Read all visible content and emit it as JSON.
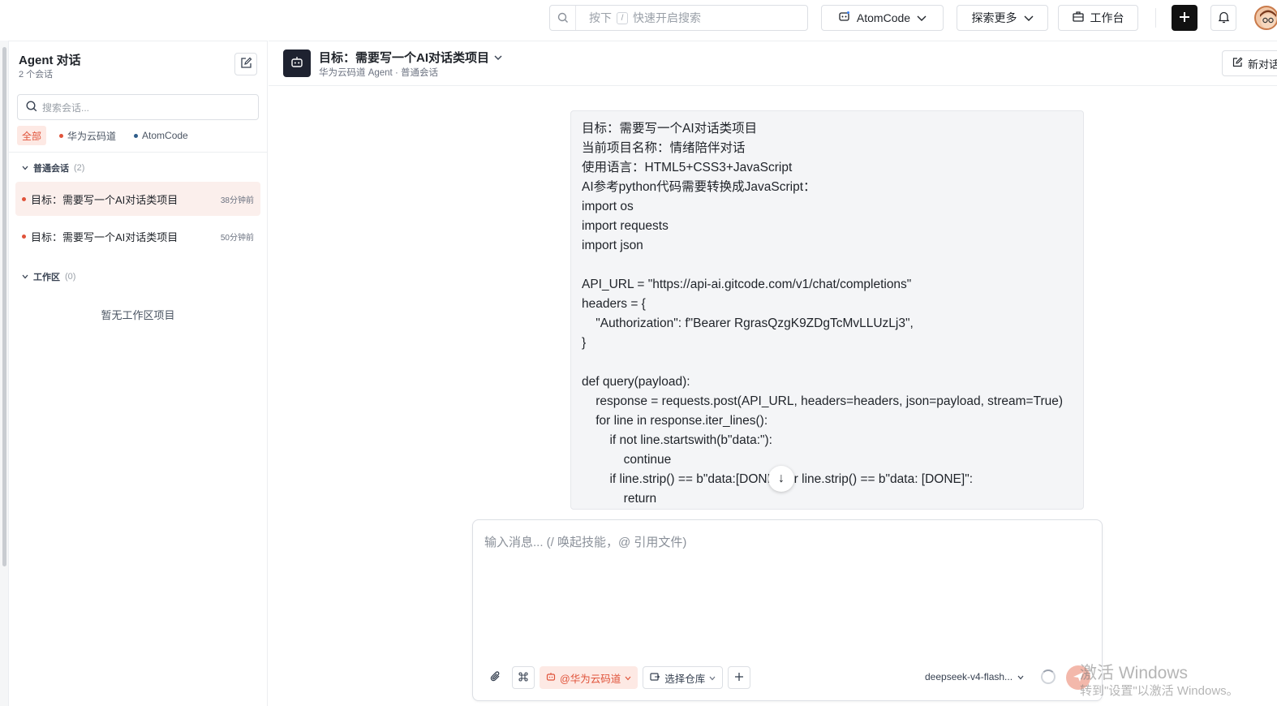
{
  "topbar": {
    "search_hint_prefix": "按下",
    "search_hint_key": "/",
    "search_hint_suffix": "快速开启搜索",
    "atomcode_label": "AtomCode",
    "explore_label": "探索更多",
    "workbench_label": "工作台"
  },
  "sidebar": {
    "title": "Agent 对话",
    "subtitle": "2 个会话",
    "search_placeholder": "搜索会话...",
    "filters": [
      {
        "label": "全部"
      },
      {
        "label": "华为云码道",
        "color": "#e0533a"
      },
      {
        "label": "AtomCode",
        "color": "#2f5d8a"
      }
    ],
    "groups": {
      "normal": {
        "label": "普通会话",
        "count": "(2)"
      },
      "workspace": {
        "label": "工作区",
        "count": "(0)"
      }
    },
    "conversations": [
      {
        "title": "目标：需要写一个AI对话类项目",
        "time": "38分钟前"
      },
      {
        "title": "目标：需要写一个AI对话类项目",
        "time": "50分钟前"
      }
    ],
    "workspace_empty": "暂无工作区项目"
  },
  "main": {
    "title": "目标：需要写一个AI对话类项目",
    "subtitle": "华为云码道 Agent · 普通会话",
    "new_conv_label": "新对话"
  },
  "message": {
    "lines": [
      "目标：需要写一个AI对话类项目",
      "当前项目名称：情绪陪伴对话",
      "使用语言：HTML5+CSS3+JavaScript",
      "AI参考python代码需要转换成JavaScript：",
      "import os",
      "import requests",
      "import json",
      "",
      "API_URL = \"https://api-ai.gitcode.com/v1/chat/completions\"",
      "headers = {",
      "    \"Authorization\": f\"Bearer RgrasQzgK9ZDgTcMvLLUzLj3\",",
      "}",
      "",
      "def query(payload):",
      "    response = requests.post(API_URL, headers=headers, json=payload, stream=True)",
      "    for line in response.iter_lines():",
      "        if not line.startswith(b\"data:\"):",
      "            continue",
      "        if line.strip() == b\"data:[DONE]\" or line.strip() == b\"data: [DONE]\":",
      "            return"
    ],
    "scroll_down_glyph": "↓"
  },
  "composer": {
    "placeholder": "输入消息...   (/ 唤起技能，@ 引用文件)",
    "agent_chip": "@华为云码道",
    "repo_chip": "选择仓库",
    "model": "deepseek-v4-flash..."
  },
  "watermark": {
    "line1": "激活 Windows",
    "line2": "转到\"设置\"以激活 Windows。"
  },
  "colors": {
    "accent": "#e0533a",
    "atomcode_dot": "#2f5d8a",
    "logo_bg": "#1e2230"
  }
}
